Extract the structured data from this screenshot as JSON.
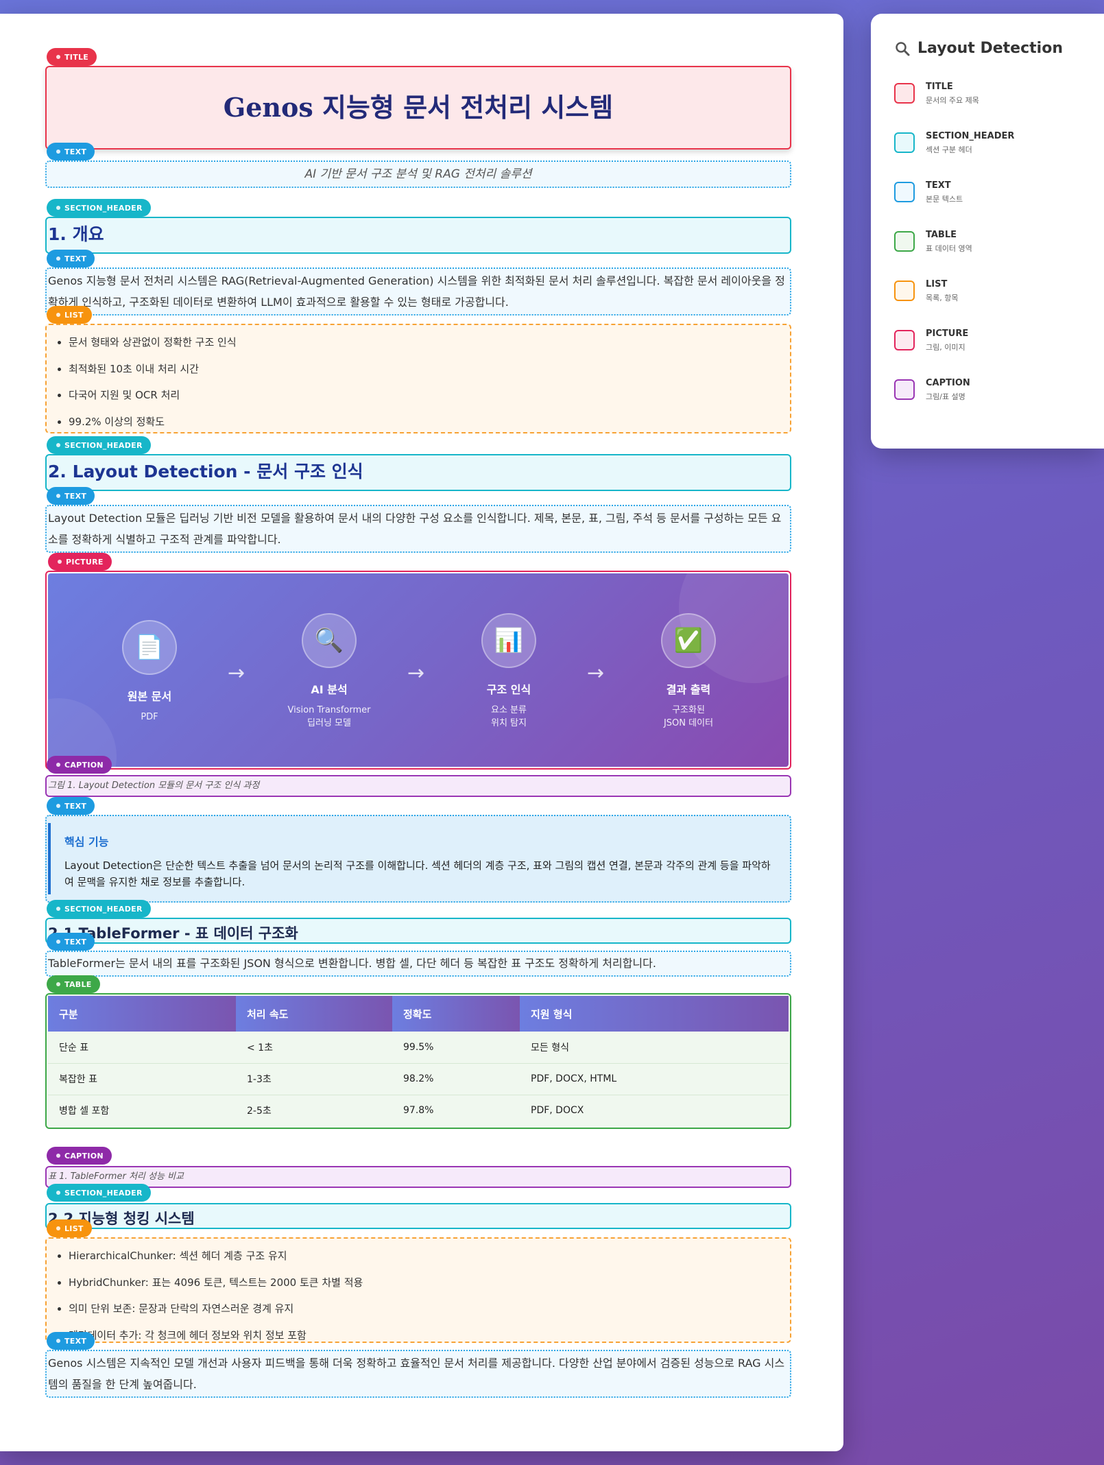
{
  "badges": {
    "title": "TITLE",
    "text": "TEXT",
    "section_header": "SECTION_HEADER",
    "list": "LIST",
    "picture": "PICTURE",
    "caption": "CAPTION",
    "table": "TABLE"
  },
  "doc": {
    "title": "Genos 지능형 문서 전처리 시스템",
    "subtitle": "AI 기반 문서 구조 분석 및 RAG 전처리 솔루션",
    "s1_header": "1. 개요",
    "s1_text": "Genos 지능형 문서 전처리 시스템은 RAG(Retrieval-Augmented Generation) 시스템을 위한 최적화된 문서 처리 솔루션입니다. 복잡한 문서 레이아웃을 정확하게 인식하고, 구조화된 데이터로 변환하여 LLM이 효과적으로 활용할 수 있는 형태로 가공합니다.",
    "s1_list": [
      "문서 형태와 상관없이 정확한 구조 인식",
      "최적화된 10초 이내 처리 시간",
      "다국어 지원 및 OCR 처리",
      "99.2% 이상의 정확도"
    ],
    "s2_header": "2. Layout Detection - 문서 구조 인식",
    "s2_text": "Layout Detection 모듈은 딥러닝 기반 비전 모델을 활용하여 문서 내의 다양한 구성 요소를 인식합니다. 제목, 본문, 표, 그림, 주석 등 문서를 구성하는 모든 요소를 정확하게 식별하고 구조적 관계를 파악합니다.",
    "picture": {
      "steps": [
        {
          "icon": "📄",
          "name": "원본 문서",
          "desc": [
            "PDF"
          ]
        },
        {
          "icon": "🔍",
          "name": "AI 분석",
          "desc": [
            "Vision Transformer",
            "딥러닝 모델"
          ]
        },
        {
          "icon": "📊",
          "name": "구조 인식",
          "desc": [
            "요소 분류",
            "위치 탐지"
          ]
        },
        {
          "icon": "✅",
          "name": "결과 출력",
          "desc": [
            "구조화된",
            "JSON 데이터"
          ]
        }
      ],
      "arrow": "→"
    },
    "fig_caption": "그림 1. Layout Detection 모듈의 문서 구조 인식 과정",
    "key": {
      "title": "핵심 기능",
      "body": "Layout Detection은 단순한 텍스트 추출을 넘어 문서의 논리적 구조를 이해합니다. 섹션 헤더의 계층 구조, 표와 그림의 캡션 연결, 본문과 각주의 관계 등을 파악하여 문맥을 유지한 채로 정보를 추출합니다."
    },
    "s21_header": "2.1 TableFormer - 표 데이터 구조화",
    "s21_text": "TableFormer는 문서 내의 표를 구조화된 JSON 형식으로 변환합니다. 병합 셀, 다단 헤더 등 복잡한 표 구조도 정확하게 처리합니다.",
    "table": {
      "headers": [
        "구분",
        "처리 속도",
        "정확도",
        "지원 형식"
      ],
      "rows": [
        [
          "단순 표",
          "< 1초",
          "99.5%",
          "모든 형식"
        ],
        [
          "복잡한 표",
          "1-3초",
          "98.2%",
          "PDF, DOCX, HTML"
        ],
        [
          "병합 셀 포함",
          "2-5초",
          "97.8%",
          "PDF, DOCX"
        ]
      ]
    },
    "table_caption": "표 1. TableFormer 처리 성능 비교",
    "s22_header": "2.2 지능형 청킹 시스템",
    "s22_list": [
      "HierarchicalChunker: 섹션 헤더 계층 구조 유지",
      "HybridChunker: 표는 4096 토큰, 텍스트는 2000 토큰 차별 적용",
      "의미 단위 보존: 문장과 단락의 자연스러운 경계 유지",
      "메타데이터 추가: 각 청크에 헤더 정보와 위치 정보 포함"
    ],
    "final_text": "Genos 시스템은 지속적인 모델 개선과 사용자 피드백을 통해 더욱 정확하고 효율적인 문서 처리를 제공합니다. 다양한 산업 분야에서 검증된 성능으로 RAG 시스템의 품질을 한 단계 높여줍니다."
  },
  "legend": {
    "title": "Layout Detection",
    "title_icon": "search-icon",
    "items": [
      {
        "name": "TITLE",
        "desc": "문서의 주요 제목",
        "color": "#e8334a",
        "fill": "#fde8ea"
      },
      {
        "name": "SECTION_HEADER",
        "desc": "섹션 구분 헤더",
        "color": "#17b6c9",
        "fill": "#e8f9fc"
      },
      {
        "name": "TEXT",
        "desc": "본문 텍스트",
        "color": "#1e9be0",
        "fill": "#f0f9fe"
      },
      {
        "name": "TABLE",
        "desc": "표 데이터 영역",
        "color": "#3da848",
        "fill": "#f0f8ef"
      },
      {
        "name": "LIST",
        "desc": "목록, 항목",
        "color": "#f7930e",
        "fill": "#fff7ec"
      },
      {
        "name": "PICTURE",
        "desc": "그림, 이미지",
        "color": "#e3245c",
        "fill": "#fdeaf0"
      },
      {
        "name": "CAPTION",
        "desc": "그림/표 설명",
        "color": "#9a36b4",
        "fill": "#f6eafa"
      }
    ]
  }
}
